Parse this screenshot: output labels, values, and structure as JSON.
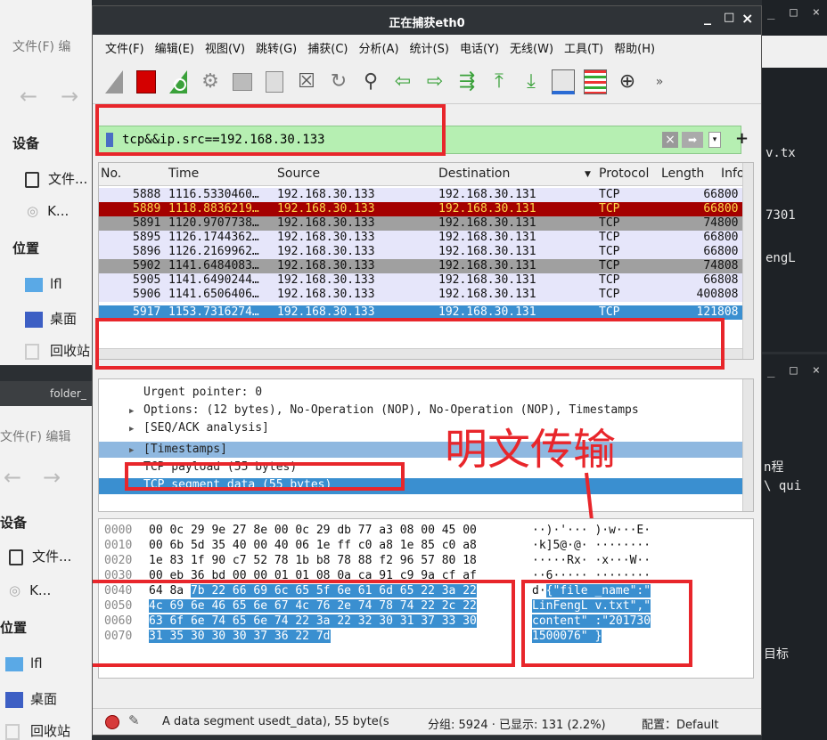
{
  "bg_left_top": {
    "menu": "文件(F)  编",
    "side_devices": "设备",
    "side_file": "文件...",
    "side_k": "K...",
    "side_places": "位置",
    "side_lfl": "lfl",
    "side_desktop": "桌面",
    "side_trash": "回收站"
  },
  "bg_left_bottom": {
    "title": "folder_",
    "menu": "文件(F)  编辑",
    "side_devices": "设备",
    "side_file": "文件...",
    "side_k": "K...",
    "side_places": "位置",
    "side_lfl": "lfl",
    "side_desktop": "桌面",
    "side_trash": "回收站"
  },
  "term_top": {
    "l1": "v.tx",
    "l2": "7301",
    "l3": "engL"
  },
  "term_bottom": {
    "l1": "n程",
    "l2": "\\ qui",
    "l3": "目标"
  },
  "window": {
    "title": "正在捕获eth0",
    "min": "_",
    "max": "□",
    "close": "×"
  },
  "menu": [
    "文件(F)",
    "编辑(E)",
    "视图(V)",
    "跳转(G)",
    "捕获(C)",
    "分析(A)",
    "统计(S)",
    "电话(Y)",
    "无线(W)",
    "工具(T)",
    "帮助(H)"
  ],
  "filter": {
    "value": "tcp&&ip.src==192.168.30.133",
    "plus": "+"
  },
  "columns": [
    "No.",
    "Time",
    "Source",
    "Destination",
    "Protocol",
    "Length",
    "Info"
  ],
  "packets": [
    {
      "no": "5888",
      "time": "1116.5330460…",
      "src": "192.168.30.133",
      "dst": "192.168.30.131",
      "proto": "TCP",
      "len": "66",
      "info": "800",
      "style": "lav"
    },
    {
      "no": "5889",
      "time": "1118.8836219…",
      "src": "192.168.30.133",
      "dst": "192.168.30.131",
      "proto": "TCP",
      "len": "66",
      "info": "800",
      "style": "red"
    },
    {
      "no": "5891",
      "time": "1120.9707738…",
      "src": "192.168.30.133",
      "dst": "192.168.30.131",
      "proto": "TCP",
      "len": "74",
      "info": "800",
      "style": "gray"
    },
    {
      "no": "5895",
      "time": "1126.1744362…",
      "src": "192.168.30.133",
      "dst": "192.168.30.131",
      "proto": "TCP",
      "len": "66",
      "info": "800",
      "style": "lav"
    },
    {
      "no": "5896",
      "time": "1126.2169962…",
      "src": "192.168.30.133",
      "dst": "192.168.30.131",
      "proto": "TCP",
      "len": "66",
      "info": "800",
      "style": "lav"
    },
    {
      "no": "5902",
      "time": "1141.6484083…",
      "src": "192.168.30.133",
      "dst": "192.168.30.131",
      "proto": "TCP",
      "len": "74",
      "info": "808",
      "style": "gray"
    },
    {
      "no": "5905",
      "time": "1141.6490244…",
      "src": "192.168.30.133",
      "dst": "192.168.30.131",
      "proto": "TCP",
      "len": "66",
      "info": "808",
      "style": "lav"
    },
    {
      "no": "5906",
      "time": "1141.6506406…",
      "src": "192.168.30.133",
      "dst": "192.168.30.131",
      "proto": "TCP",
      "len": "400",
      "info": "808",
      "style": "lav"
    },
    {
      "no": "5917",
      "time": "1153.7316274…",
      "src": "192.168.30.133",
      "dst": "192.168.30.131",
      "proto": "TCP",
      "len": "121",
      "info": "808",
      "style": "sel"
    }
  ],
  "details": [
    "Urgent pointer: 0",
    "Options: (12 bytes), No-Operation (NOP), No-Operation (NOP), Timestamps",
    "[SEQ/ACK analysis]",
    "[Timestamps]",
    "TCP payload (55 bytes)",
    "TCP segment data (55 bytes)"
  ],
  "annotation": "明文传输",
  "hex": [
    {
      "off": "0000",
      "bytes": "00 0c 29 9e 27 8e 00 0c  29 db 77 a3 08 00 45 00",
      "asc": "··)·'···  )·w···E·"
    },
    {
      "off": "0010",
      "bytes": "00 6b 5d 35 40 00 40 06  1e ff c0 a8 1e 85 c0 a8",
      "asc": "·k]5@·@·  ········"
    },
    {
      "off": "0020",
      "bytes": "1e 83 1f 90 c7 52 78 1b  b8 78 88 f2 96 57 80 18",
      "asc": "·····Rx·  ·x···W··"
    },
    {
      "off": "0030",
      "bytes": "00 eb 36 bd 00 00 01 01  08 0a ca 91 c9 9a cf af",
      "asc": "··6·····  ········"
    },
    {
      "off": "0040",
      "b_plain": "64 8a ",
      "b_sel": "7b 22 66 69 6c 65  5f 6e 61 6d 65 22 3a 22",
      "a_plain": "d·",
      "a_sel": "{\"file  _name\":\""
    },
    {
      "off": "0050",
      "b_sel": "4c 69 6e 46 65 6e 67 4c  76 2e 74 78 74 22 2c 22",
      "a_sel": "LinFengL  v.txt\",\""
    },
    {
      "off": "0060",
      "b_sel": "63 6f 6e 74 65 6e 74 22  3a 22 32 30 31 37 33 30",
      "a_sel": "content\"  :\"201730"
    },
    {
      "off": "0070",
      "b_sel": "31 35 30 30 30 37 36 22  7d",
      "a_sel": "1500076\"  }"
    }
  ],
  "status": {
    "text": "A data segment usedt_data), 55 byte(s",
    "packets": "分组: 5924 · 已显示: 131 (2.2%)",
    "profile": "配置：Default"
  },
  "colors": {
    "selected": "#3a8fd0",
    "red_row": "#a40000",
    "lavender": "#e6e6fa",
    "gray_row": "#a0a0a0",
    "filter_ok": "#b6efb2",
    "annotation": "#e8262b"
  }
}
